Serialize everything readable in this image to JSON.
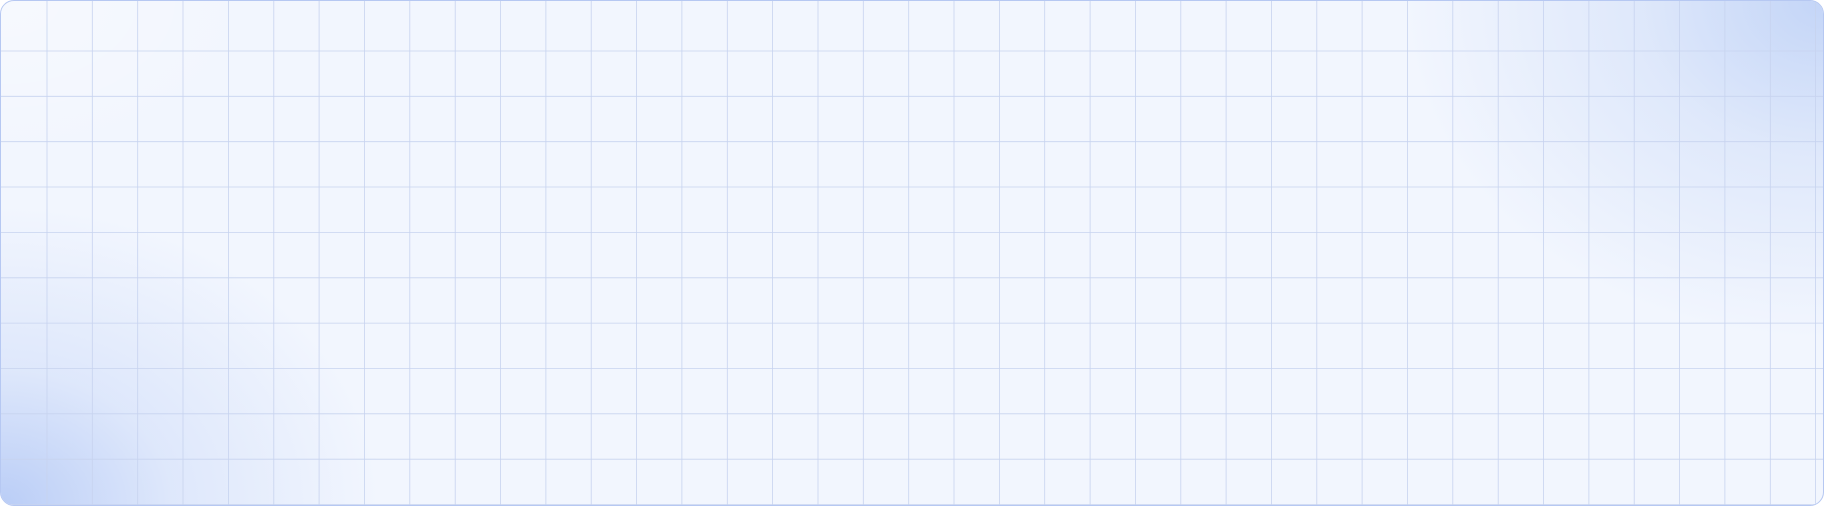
{
  "panel": {
    "background_color": "#f2f6fe",
    "border_color": "#b6c8f2",
    "grid_line_color": "#c7d3ef",
    "glow_color": "#b4caf5"
  }
}
